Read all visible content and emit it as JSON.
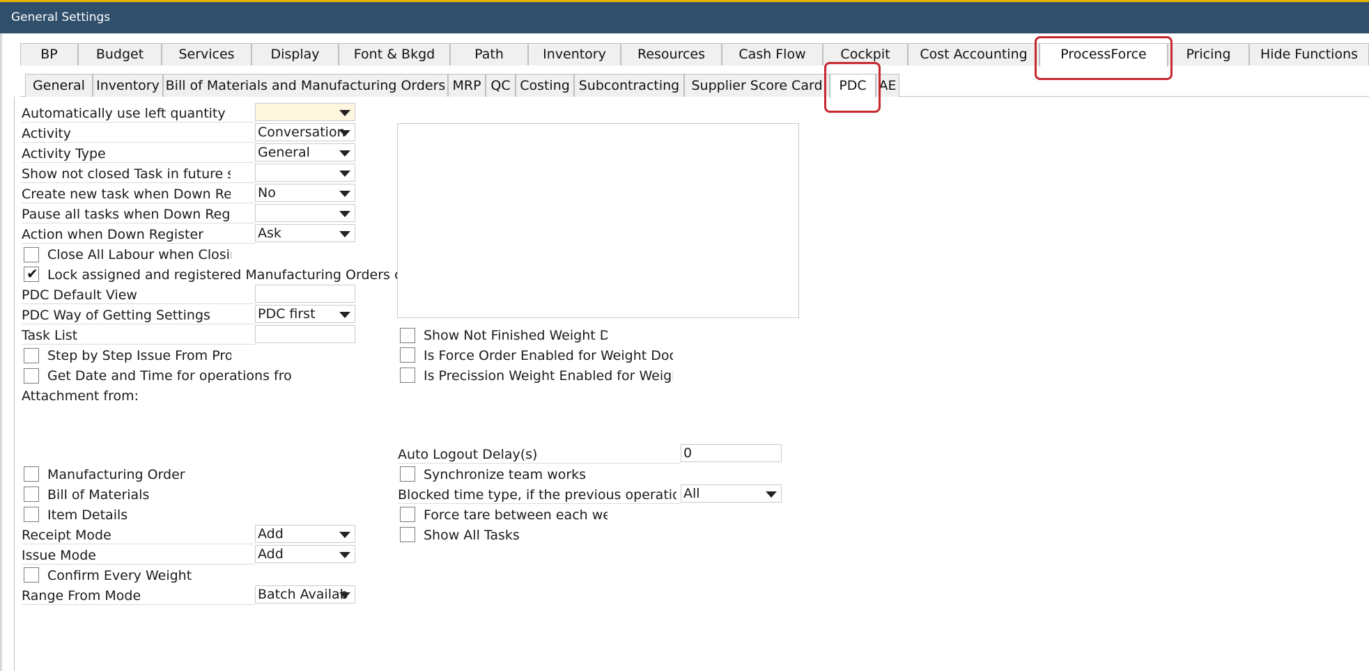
{
  "window": {
    "title": "General Settings"
  },
  "tabs_main": [
    {
      "label": "BP"
    },
    {
      "label": "Budget"
    },
    {
      "label": "Services"
    },
    {
      "label": "Display"
    },
    {
      "label": "Font & Bkgd"
    },
    {
      "label": "Path"
    },
    {
      "label": "Inventory"
    },
    {
      "label": "Resources"
    },
    {
      "label": "Cash Flow"
    },
    {
      "label": "Cockpit"
    },
    {
      "label": "Cost Accounting"
    },
    {
      "label": "ProcessForce"
    },
    {
      "label": "Pricing"
    },
    {
      "label": "Hide Functions"
    }
  ],
  "tabs_sub": [
    {
      "label": "General"
    },
    {
      "label": "Inventory"
    },
    {
      "label": "Bill of Materials and Manufacturing Orders"
    },
    {
      "label": "MRP"
    },
    {
      "label": "QC"
    },
    {
      "label": "Costing"
    },
    {
      "label": "Subcontracting"
    },
    {
      "label": "Supplier Score Card"
    },
    {
      "label": "PDC"
    },
    {
      "label": "AE"
    }
  ],
  "left": {
    "auto_left_qty": {
      "label": "Automatically use left quantity as",
      "value": ""
    },
    "activity": {
      "label": "Activity",
      "value": "Conversation"
    },
    "activity_type": {
      "label": "Activity Type",
      "value": "General"
    },
    "show_not_closed": {
      "label": "Show not closed Task in future se",
      "value": ""
    },
    "create_new_task": {
      "label": "Create new task when Down Regi",
      "value": "No"
    },
    "pause_all": {
      "label": "Pause all tasks when Down Regis",
      "value": ""
    },
    "action_down": {
      "label": "Action when Down Register",
      "value": "Ask"
    },
    "close_all_labour": {
      "label": "Close All Labour when Closing",
      "checked": false
    },
    "lock_assigned": {
      "label": "Lock assigned and registered Manufacturing Orders on G",
      "checked": true
    },
    "pdc_default_view": {
      "label": "PDC Default View",
      "value": ""
    },
    "pdc_way": {
      "label": "PDC Way of Getting Settings",
      "value": "PDC first"
    },
    "task_list": {
      "label": "Task List",
      "value": ""
    },
    "step_by_step": {
      "label": "Step by Step Issue From Prod",
      "checked": false
    },
    "get_date_time": {
      "label": "Get Date and Time for operations from",
      "checked": false
    },
    "attachment_from": {
      "label": "Attachment from:"
    },
    "mfg_order": {
      "label": "Manufacturing Order",
      "checked": false
    },
    "bom": {
      "label": "Bill of Materials",
      "checked": false
    },
    "item_details": {
      "label": "Item Details",
      "checked": false
    },
    "receipt_mode": {
      "label": "Receipt Mode",
      "value": "Add"
    },
    "issue_mode": {
      "label": "Issue Mode",
      "value": "Add"
    },
    "confirm_weight": {
      "label": "Confirm Every Weight",
      "checked": false
    },
    "range_from_mode": {
      "label": "Range From Mode",
      "value": "Batch Availab"
    }
  },
  "right": {
    "show_not_finished": {
      "label": "Show Not Finished Weight Do",
      "checked": false
    },
    "force_order": {
      "label": "Is Force Order Enabled for Weight Docur",
      "checked": false
    },
    "precision_weight": {
      "label": "Is Precission Weight Enabled for Weight",
      "checked": false
    },
    "auto_logout": {
      "label": "Auto Logout Delay(s)",
      "value": "0"
    },
    "sync_team": {
      "label": "Synchronize team works",
      "checked": false
    },
    "blocked_time": {
      "label": "Blocked time type, if the previous operation v",
      "value": "All"
    },
    "force_tare": {
      "label": "Force tare between each weig",
      "checked": false
    },
    "show_all_tasks": {
      "label": "Show All Tasks",
      "checked": false
    }
  },
  "colors": {
    "titlebar": "#2f4f6b",
    "highlight": "#c6282e",
    "required_field": "#fff6df"
  },
  "icons": {
    "dropdown": "chevron-down-icon",
    "check": "checkmark-icon"
  }
}
